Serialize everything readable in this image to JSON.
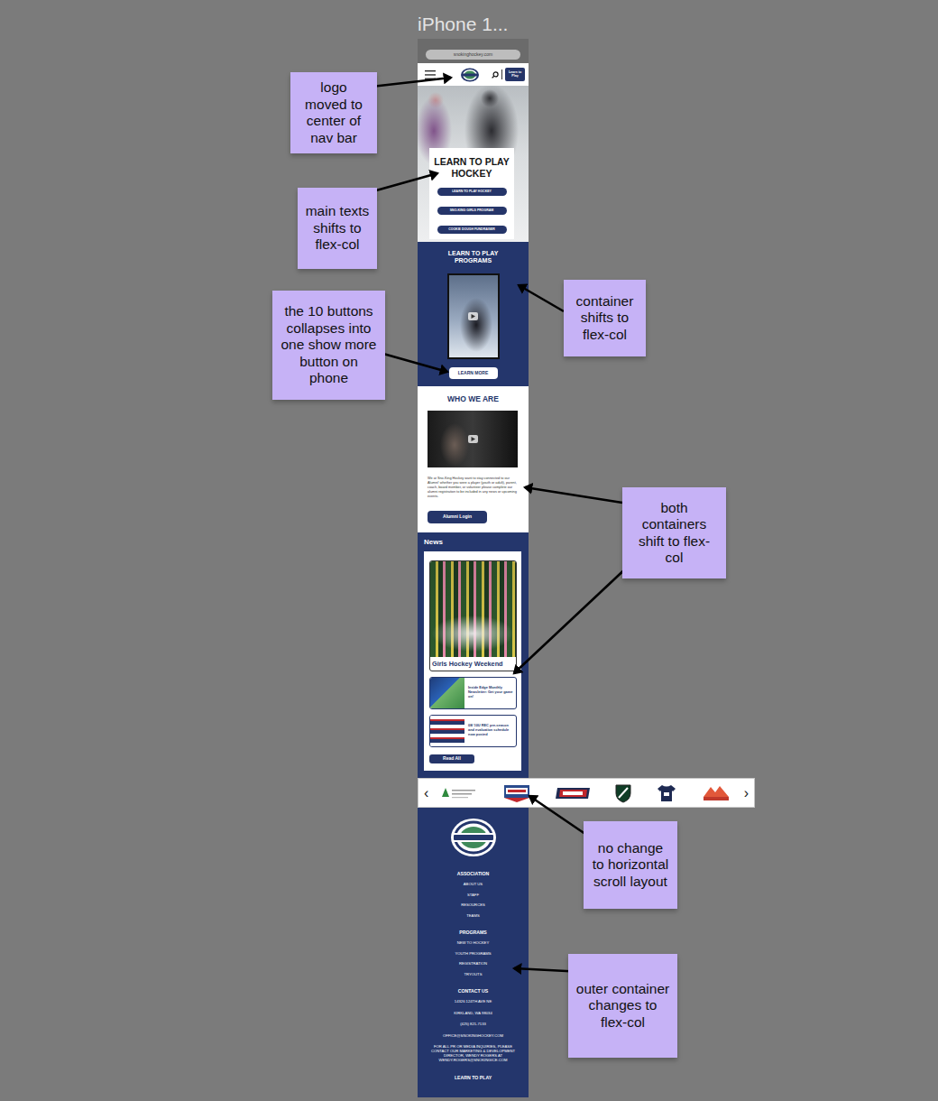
{
  "canvas": {
    "title": "iPhone 1..."
  },
  "browser": {
    "url": "snokinghockey.com"
  },
  "navbar": {
    "cta": "Learn to Play"
  },
  "hero": {
    "title": "LEARN TO PLAY HOCKEY",
    "buttons": [
      "LEARN TO PLAY HOCKEY",
      "SNO-KING GIRLS PROGRAM",
      "COOKIE DOUGH FUNDRAISER"
    ]
  },
  "programs": {
    "title": "LEARN TO PLAY PROGRAMS",
    "button": "LEARN MORE"
  },
  "about": {
    "title": "WHO WE ARE",
    "text": "We at Sno-King Hockey want to stay connected to our Alumni! whether you were a player (youth or adult), parent, coach, board member, or volunteer please complete our alumni registration to be included in any news or upcoming events.",
    "button": "Alumni Login"
  },
  "news": {
    "title": "News",
    "featured": "Girls Hockey Weekend",
    "items": [
      "Inside Edge Monthly Newsletter: Get your game on!",
      "08/ 10U REC pre-season and evaluation schedule now posted"
    ],
    "button": "Read All"
  },
  "sponsors": {
    "prev": "‹",
    "next": "›"
  },
  "footer": {
    "sections": [
      {
        "title": "ASSOCIATION",
        "links": [
          "ABOUT US",
          "STAFF",
          "RESOURCES",
          "TEAMS"
        ]
      },
      {
        "title": "PROGRAMS",
        "links": [
          "NEW TO HOCKEY",
          "YOUTH PROGRAMS",
          "REGISTRATION",
          "TRYOUTS"
        ]
      }
    ],
    "contact": {
      "title": "CONTACT US",
      "lines": [
        "14326 124TH AVE NE",
        "KIRKLAND, WA 98034",
        "(425) 821-7133",
        "OFFICE@SNOKINGHOCKEY.COM"
      ],
      "note": "FOR ALL PR OR MEDIA INQUIRIES, PLEASE CONTACT OUR MARKETING & DEVELOPMENT DIRECTOR, WENDY ROGERS AT WENDY.ROGERS@SNOKINGICE.COM"
    },
    "bottom": "LEARN TO PLAY"
  },
  "notes": [
    "logo moved to center of nav bar",
    "main texts shifts to flex-col",
    "the 10 buttons collapses into one show more button on phone",
    "container shifts to flex-col",
    "both containers shift to flex-col",
    "no change to horizontal scroll layout",
    "outer container changes to flex-col"
  ]
}
